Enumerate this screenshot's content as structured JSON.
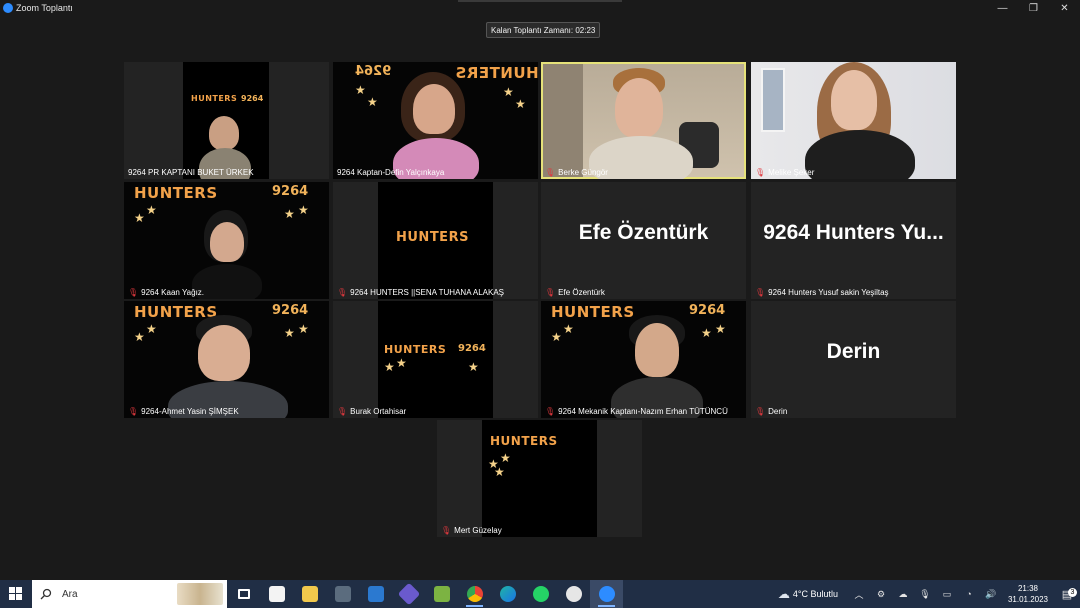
{
  "window": {
    "title": "Zoom Toplantı",
    "controls": [
      "—",
      "❐",
      "✕"
    ]
  },
  "meeting": {
    "timer_label": "Kalan Toplantı Zamanı: 02:23"
  },
  "participants": [
    {
      "name": "9264 PR KAPTANI BUKET ÜRKEK",
      "muted": false,
      "video": true
    },
    {
      "name": "9264 Kaptan-Defin Yalçınkaya",
      "muted": false,
      "video": true
    },
    {
      "name": "Berke Güngör",
      "muted": true,
      "video": true,
      "active_speaker": true
    },
    {
      "name": "Melike Şeker",
      "muted": true,
      "video": true
    },
    {
      "name": "9264 Kaan Yağız.",
      "muted": true,
      "video": true
    },
    {
      "name": "9264 HUNTERS ||SENA TUHANA ALAKAŞ",
      "muted": true,
      "video": true
    },
    {
      "name": "Efe Özentürk",
      "muted": true,
      "video": false,
      "display_name": "Efe Özentürk"
    },
    {
      "name": "9264 Hunters Yusuf sakin Yeşiltaş",
      "muted": true,
      "video": false,
      "display_name": "9264 Hunters Yu..."
    },
    {
      "name": "9264-Ahmet Yasin ŞİMŞEK",
      "muted": true,
      "video": true
    },
    {
      "name": "Burak Ortahisar",
      "muted": true,
      "video": true
    },
    {
      "name": "9264 Mekanik Kaptanı-Nazım Erhan TÜTÜNCÜ",
      "muted": true,
      "video": true
    },
    {
      "name": "Derin",
      "muted": true,
      "video": false,
      "display_name": "Derin"
    },
    {
      "name": "Mert Güzelay",
      "muted": true,
      "video": true
    }
  ],
  "background": {
    "team_word": "HUNTERS",
    "team_number": "9264"
  },
  "taskbar": {
    "search_placeholder": "Ara",
    "apps": [
      "task-view-icon",
      "store-icon",
      "file-explorer-icon",
      "calculator-icon",
      "mail-icon",
      "vpn-icon",
      "minecraft-icon",
      "chrome-icon",
      "edge-icon",
      "whatsapp-icon",
      "steam-icon",
      "zoom-icon"
    ],
    "weather": "4°C  Bulutlu",
    "time": "21:38",
    "date": "31.01.2023",
    "notification_count": "3"
  },
  "colors": {
    "active_speaker": "#e6e27a",
    "muted_mic": "#e0383e",
    "taskbar": "#202e45",
    "hunters_orange": "#f2a24a"
  }
}
